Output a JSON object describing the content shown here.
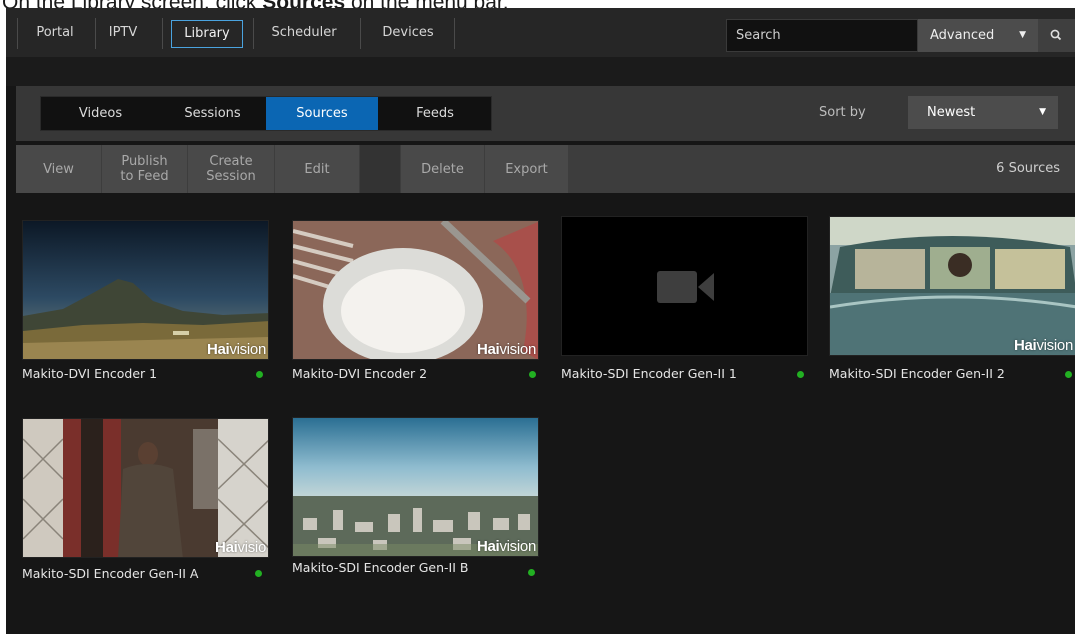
{
  "instruction": {
    "prefix": "On the Library screen, click ",
    "bold": "Sources",
    "suffix": " on the menu bar."
  },
  "topnav": {
    "tabs": [
      {
        "label": "Portal"
      },
      {
        "label": "IPTV"
      },
      {
        "label": "Library",
        "active": true
      },
      {
        "label": "Scheduler"
      },
      {
        "label": "Devices"
      }
    ],
    "search": {
      "placeholder": "Search"
    },
    "advanced_label": "Advanced",
    "search_icon": "search-icon"
  },
  "library": {
    "tabs": [
      {
        "label": "Videos"
      },
      {
        "label": "Sessions"
      },
      {
        "label": "Sources",
        "active": true
      },
      {
        "label": "Feeds"
      }
    ],
    "sort_label": "Sort by",
    "sort_value": "Newest"
  },
  "toolbar": {
    "view": "View",
    "publish_line1": "Publish",
    "publish_line2": "to Feed",
    "create_line1": "Create",
    "create_line2": "Session",
    "edit": "Edit",
    "delete": "Delete",
    "export": "Export",
    "count": "6 Sources"
  },
  "sources": [
    {
      "name": "Makito-DVI Encoder 1",
      "status": "online",
      "watermark_bold": "Hai",
      "watermark_thin": "vision",
      "thumb": "mountain-landscape"
    },
    {
      "name": "Makito-DVI Encoder 2",
      "status": "online",
      "watermark_bold": "Hai",
      "watermark_thin": "vision",
      "thumb": "cup-closeup"
    },
    {
      "name": "Makito-SDI Encoder Gen-II 1",
      "status": "online",
      "thumb": "video-camera-placeholder-icon"
    },
    {
      "name": "Makito-SDI Encoder Gen-II 2",
      "status": "online",
      "watermark_bold": "Hai",
      "watermark_thin": "vision",
      "thumb": "vintage-car"
    },
    {
      "name": "Makito-SDI Encoder Gen-II A",
      "status": "online",
      "watermark_bold": "Hai",
      "watermark_thin": "visio",
      "thumb": "man-in-doorway"
    },
    {
      "name": "Makito-SDI Encoder Gen-II B",
      "status": "online",
      "watermark_bold": "Hai",
      "watermark_thin": "vision",
      "thumb": "city-aerial"
    }
  ],
  "colors": {
    "accent": "#0b66b3",
    "status_online": "#22b022",
    "nav_active_border": "#4aa3df"
  }
}
